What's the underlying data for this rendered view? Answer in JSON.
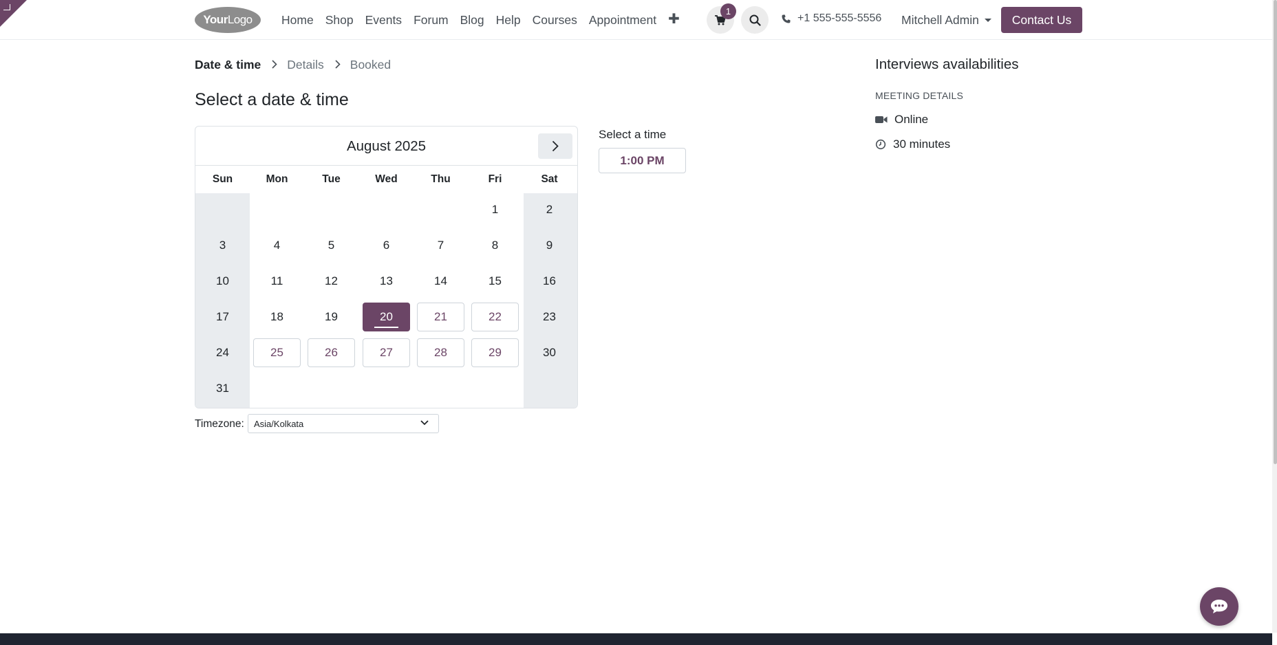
{
  "header": {
    "logo": {
      "bold": "Your",
      "regular": "Logo"
    },
    "nav": [
      "Home",
      "Shop",
      "Events",
      "Forum",
      "Blog",
      "Help",
      "Courses",
      "Appointment"
    ],
    "plus_label": "✚",
    "cart_count": "1",
    "phone": "+1 555-555-5556",
    "user": "Mitchell Admin",
    "contact_label": "Contact Us"
  },
  "breadcrumb": {
    "step1": "Date & time",
    "step2": "Details",
    "step3": "Booked"
  },
  "page_title": "Select a date & time",
  "calendar": {
    "month": "August 2025",
    "days_of_week": [
      "Sun",
      "Mon",
      "Tue",
      "Wed",
      "Thu",
      "Fri",
      "Sat"
    ],
    "weeks": [
      [
        "",
        "",
        "",
        "",
        "",
        "1",
        "2"
      ],
      [
        "3",
        "4",
        "5",
        "6",
        "7",
        "8",
        "9"
      ],
      [
        "10",
        "11",
        "12",
        "13",
        "14",
        "15",
        "16"
      ],
      [
        "17",
        "18",
        "19",
        "20",
        "21",
        "22",
        "23"
      ],
      [
        "24",
        "25",
        "26",
        "27",
        "28",
        "29",
        "30"
      ],
      [
        "31",
        "",
        "",
        "",
        "",
        "",
        ""
      ]
    ],
    "selected_day": "20",
    "available_days": [
      "21",
      "22",
      "25",
      "26",
      "27",
      "28",
      "29"
    ]
  },
  "timezone": {
    "label": "Timezone:",
    "value": "Asia/Kolkata"
  },
  "time": {
    "label": "Select a time",
    "slots": [
      "1:00 PM"
    ]
  },
  "sidebar": {
    "title": "Interviews availabilities",
    "subtitle": "MEETING DETAILS",
    "location": "Online",
    "duration": "30 minutes"
  },
  "colors": {
    "accent": "#6b4566",
    "weekend": "#e9ecef",
    "footer": "#1f2430"
  },
  "icons": {
    "cart": "cart-icon",
    "search": "search-icon",
    "phone": "phone-icon",
    "video": "video-camera-icon",
    "clock": "clock-icon",
    "chat": "chat-bubble-icon",
    "next": "chevron-right-icon",
    "select": "chevron-down-icon"
  }
}
